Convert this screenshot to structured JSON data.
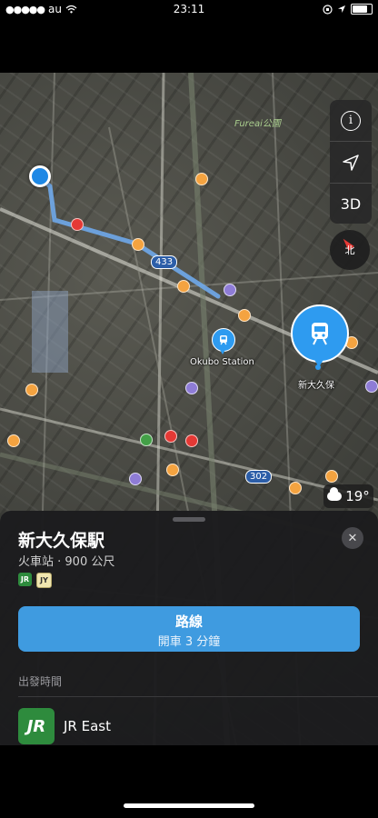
{
  "status_bar": {
    "signal_dots": "●●●●●",
    "carrier": "au",
    "time": "23:11"
  },
  "map": {
    "park_label": "Fureai公園",
    "road_shields": [
      "433",
      "302"
    ],
    "small_station_label": "Okubo Station",
    "big_station_label": "新大久保",
    "weather_temp": "19°"
  },
  "map_controls": {
    "info_icon": "info-icon",
    "location_icon": "location-arrow-icon",
    "view_3d_label": "3D",
    "compass_label": "北"
  },
  "place_card": {
    "title": "新大久保駅",
    "subtitle": "火車站 · 900 公尺",
    "badges": [
      "JR",
      "JY"
    ],
    "route_button": {
      "label": "路線",
      "detail": "開車 3 分鐘"
    },
    "section_label": "出發時間",
    "operator_logo": "JR",
    "operator_name": "JR East",
    "close_icon": "close-icon"
  },
  "colors": {
    "accent": "#3f9be0",
    "jr_green": "#2e8b3d",
    "sheet_bg": "#1c1c1e"
  }
}
